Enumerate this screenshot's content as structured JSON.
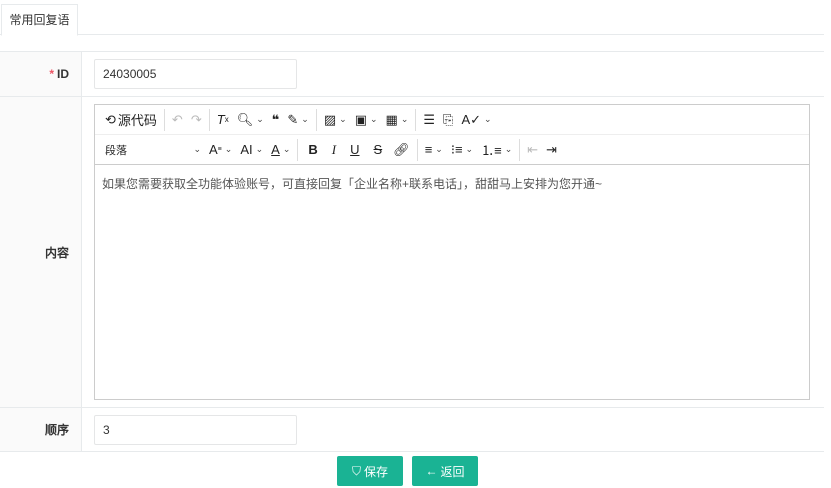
{
  "tab": {
    "label": "常用回复语"
  },
  "form": {
    "id_label": "ID",
    "id_required": "*",
    "id_value": "24030005",
    "content_label": "内容",
    "order_label": "顺序",
    "order_value": "3"
  },
  "editor": {
    "source_label": "源代码",
    "block_format": "段落",
    "content": "如果您需要获取全功能体验账号，可直接回复「企业名称+联系电话」，甜甜马上安排为您开通~"
  },
  "buttons": {
    "save": "保存",
    "back": "返回"
  },
  "colors": {
    "primary": "#1ab394",
    "required": "#ed5565"
  }
}
